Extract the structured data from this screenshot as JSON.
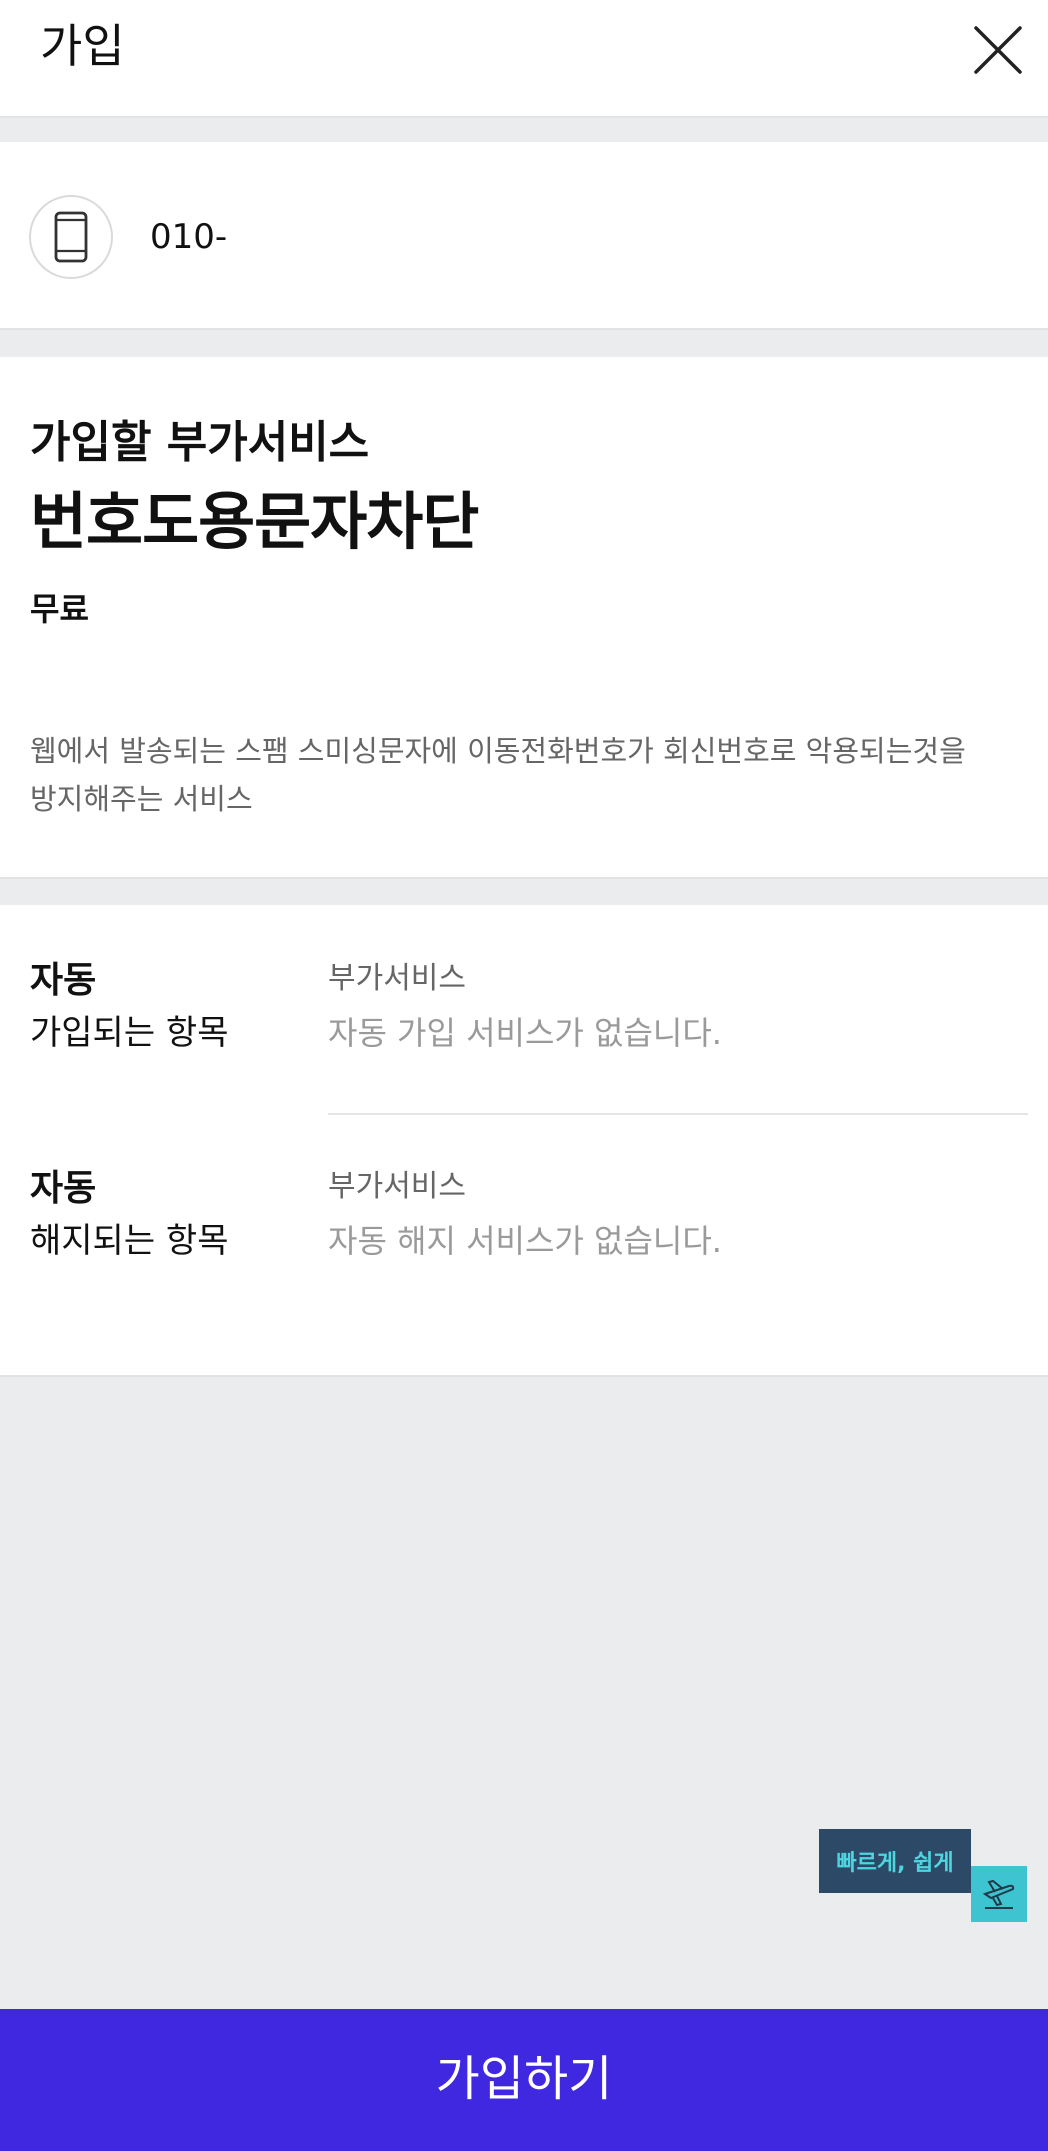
{
  "header": {
    "title": "가입",
    "close_icon": "close-icon"
  },
  "phone": {
    "icon": "smartphone-icon",
    "number": "010-"
  },
  "service": {
    "label": "가입할 부가서비스",
    "name": "번호도용문자차단",
    "price": "무료",
    "description_line1": "웹에서 발송되는 스팸 스미싱문자에 이동전화번호가 회신번호로 악용되는것을",
    "description_line2": "방지해주는 서비스"
  },
  "auto_items": [
    {
      "head_bold": "자동",
      "head_sub": "가입되는 항목",
      "col_title": "부가서비스",
      "col_value": "자동 가입 서비스가 없습니다."
    },
    {
      "head_bold": "자동",
      "head_sub": "해지되는 항목",
      "col_title": "부가서비스",
      "col_value": "자동 해지 서비스가 없습니다."
    }
  ],
  "floating": {
    "badge_text": "빠르게, 쉽게",
    "plane_icon": "airplane-icon",
    "badge_color": "#2c4a68",
    "badge_text_color": "#4ed6e0",
    "plane_bg_color": "#3ec4d0"
  },
  "cta": {
    "label": "가입하기",
    "color": "#4028e0"
  }
}
